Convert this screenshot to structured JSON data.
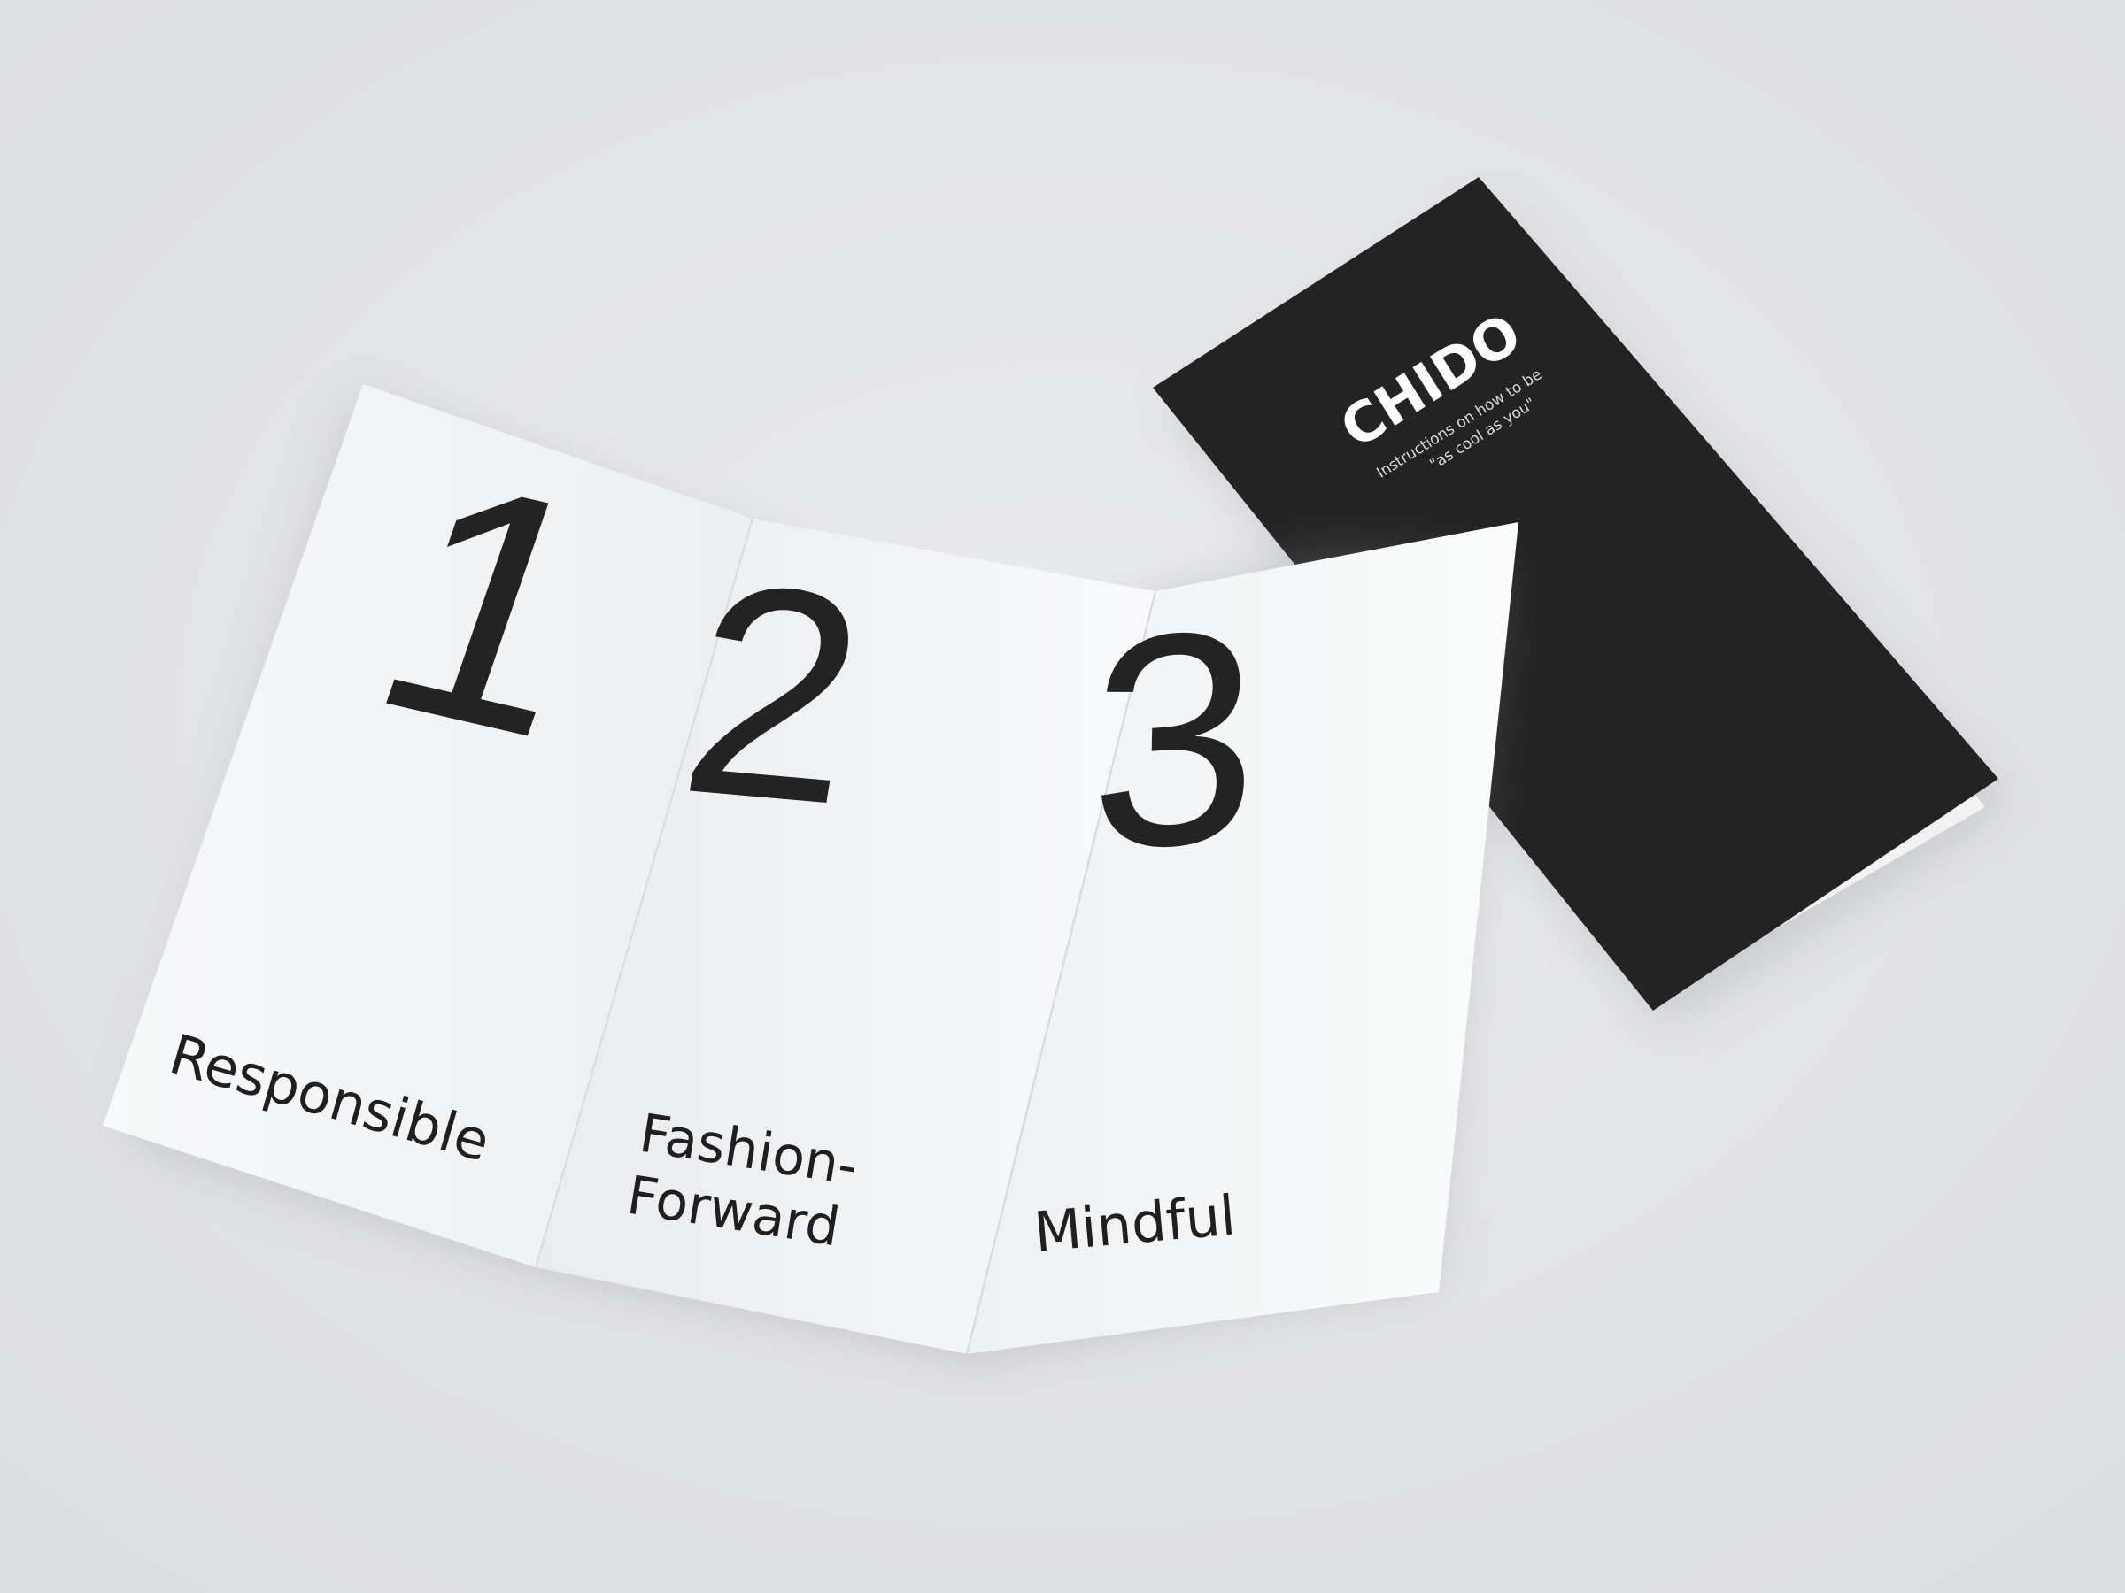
{
  "brochure_cover": {
    "brand": "CHIDO",
    "tagline_line1": "Instructions on how to be",
    "tagline_line2": "\"as cool as you\"",
    "cover_color": "#232323"
  },
  "brochure_open": {
    "panels": [
      {
        "number": "1",
        "word": "Responsible"
      },
      {
        "number": "2",
        "word_line1": "Fashion-",
        "word_line2": "Forward"
      },
      {
        "number": "3",
        "word": "Mindful"
      }
    ],
    "paper_color": "#f6f7f8",
    "ink_color": "#232323"
  }
}
